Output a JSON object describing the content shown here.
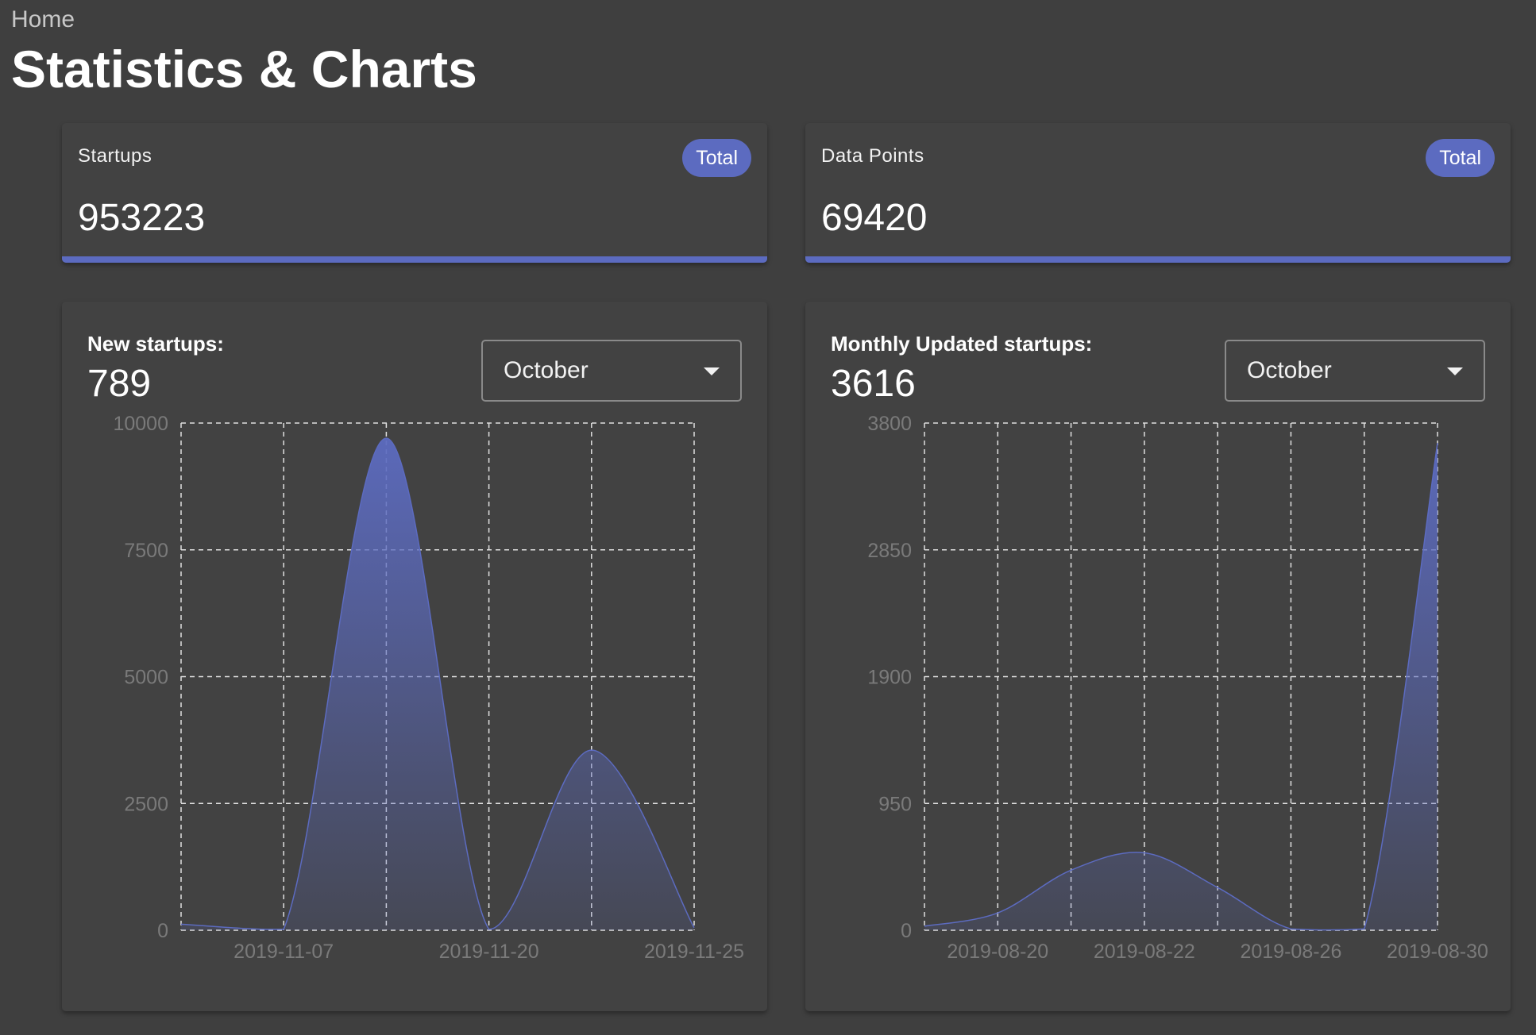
{
  "header": {
    "breadcrumb": "Home",
    "title": "Statistics & Charts"
  },
  "stats": [
    {
      "label": "Startups",
      "badge": "Total",
      "value": "953223"
    },
    {
      "label": "Data Points",
      "badge": "Total",
      "value": "69420"
    }
  ],
  "charts": [
    {
      "label": "New startups:",
      "count": "789",
      "month": "October"
    },
    {
      "label": "Monthly Updated startups:",
      "count": "3616",
      "month": "October"
    }
  ],
  "colors": {
    "accent": "#5c6bc0",
    "background": "#3f3f3f",
    "card": "#424242"
  },
  "chart_data": [
    {
      "type": "area",
      "title": "",
      "xlabel": "",
      "ylabel": "",
      "ylim": [
        0,
        10000
      ],
      "yticks": [
        "10000",
        "7500",
        "5000",
        "2500",
        "0"
      ],
      "xtick_labels": [
        "2019-11-07",
        "2019-11-20",
        "2019-11-25"
      ],
      "x": [
        "",
        "2019-11-07",
        "",
        "2019-11-20",
        "",
        "2019-11-25"
      ],
      "values": [
        120,
        20,
        9700,
        20,
        3550,
        50
      ],
      "grid": true,
      "color": "#5c6bc0"
    },
    {
      "type": "area",
      "title": "",
      "xlabel": "",
      "ylabel": "",
      "ylim": [
        0,
        3800
      ],
      "yticks": [
        "3800",
        "2850",
        "1900",
        "950",
        "0"
      ],
      "xtick_labels": [
        "2019-08-20",
        "2019-08-22",
        "2019-08-26",
        "2019-08-30"
      ],
      "x": [
        "",
        "2019-08-20",
        "",
        "2019-08-22",
        "",
        "2019-08-26",
        "",
        "2019-08-30"
      ],
      "values": [
        30,
        130,
        450,
        580,
        320,
        10,
        10,
        3650
      ],
      "grid": true,
      "color": "#5c6bc0"
    }
  ]
}
